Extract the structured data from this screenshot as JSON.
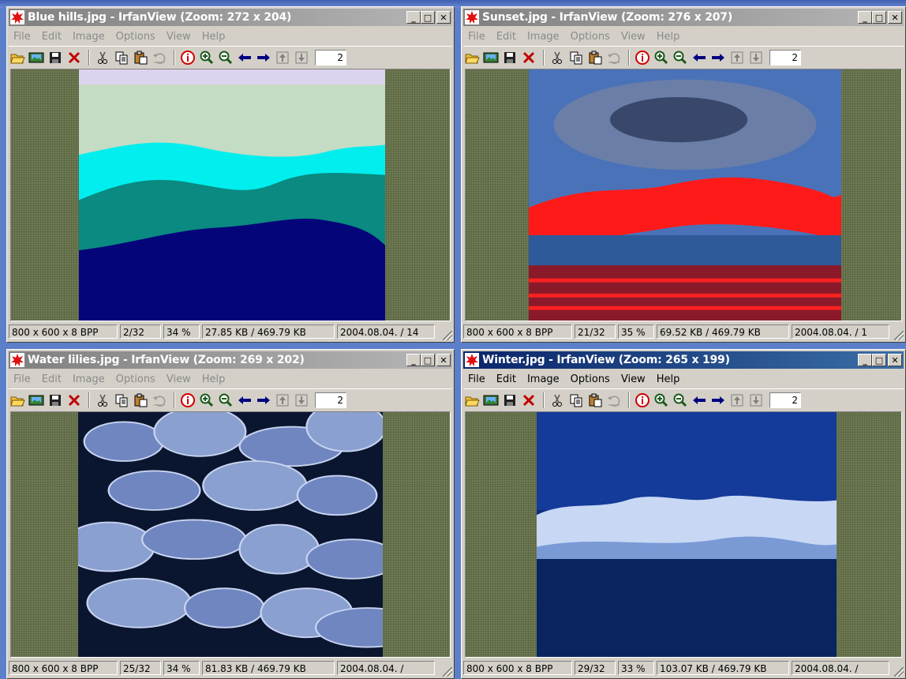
{
  "windows": [
    {
      "title": "Blue hills.jpg - IrfanView (Zoom: 272 x 204)",
      "active": false,
      "menu": [
        "File",
        "Edit",
        "Image",
        "Options",
        "View",
        "Help"
      ],
      "zoom_field": "2",
      "status": [
        "800 x 600 x 8 BPP",
        "2/32",
        "34 %",
        "27.85 KB / 469.79 KB",
        "2004.08.04. / 14"
      ]
    },
    {
      "title": "Sunset.jpg - IrfanView (Zoom: 276 x 207)",
      "active": false,
      "menu": [
        "File",
        "Edit",
        "Image",
        "Options",
        "View",
        "Help"
      ],
      "zoom_field": "2",
      "status": [
        "800 x 600 x 8 BPP",
        "21/32",
        "35 %",
        "69.52 KB / 469.79 KB",
        "2004.08.04. / 1"
      ]
    },
    {
      "title": "Water lilies.jpg - IrfanView (Zoom: 269 x 202)",
      "active": false,
      "menu": [
        "File",
        "Edit",
        "Image",
        "Options",
        "View",
        "Help"
      ],
      "zoom_field": "2",
      "status": [
        "800 x 600 x 8 BPP",
        "25/32",
        "34 %",
        "81.83 KB / 469.79 KB",
        "2004.08.04. /"
      ]
    },
    {
      "title": "Winter.jpg - IrfanView (Zoom: 265 x 199)",
      "active": true,
      "menu": [
        "File",
        "Edit",
        "Image",
        "Options",
        "View",
        "Help"
      ],
      "zoom_field": "2",
      "status": [
        "800 x 600 x 8 BPP",
        "29/32",
        "33 %",
        "103.07 KB / 469.79 KB",
        "2004.08.04. /"
      ]
    }
  ],
  "caption_buttons": {
    "minimize": "_",
    "maximize": "□",
    "close": "✕"
  },
  "toolbar_icons": [
    "open-folder-icon",
    "slideshow-icon",
    "save-icon",
    "delete-icon",
    "cut-icon",
    "copy-icon",
    "paste-icon",
    "undo-icon",
    "info-icon",
    "zoom-in-icon",
    "zoom-out-icon",
    "previous-arrow-icon",
    "next-arrow-icon",
    "first-page-icon",
    "last-page-icon"
  ],
  "colors": {
    "active_title_start": "#0a246a",
    "active_title_end": "#3a6ea5",
    "inactive_title_start": "#808080",
    "inactive_title_end": "#b6b6b6",
    "window_face": "#d4d0c8",
    "viewport_bg": "#6e7a52"
  }
}
